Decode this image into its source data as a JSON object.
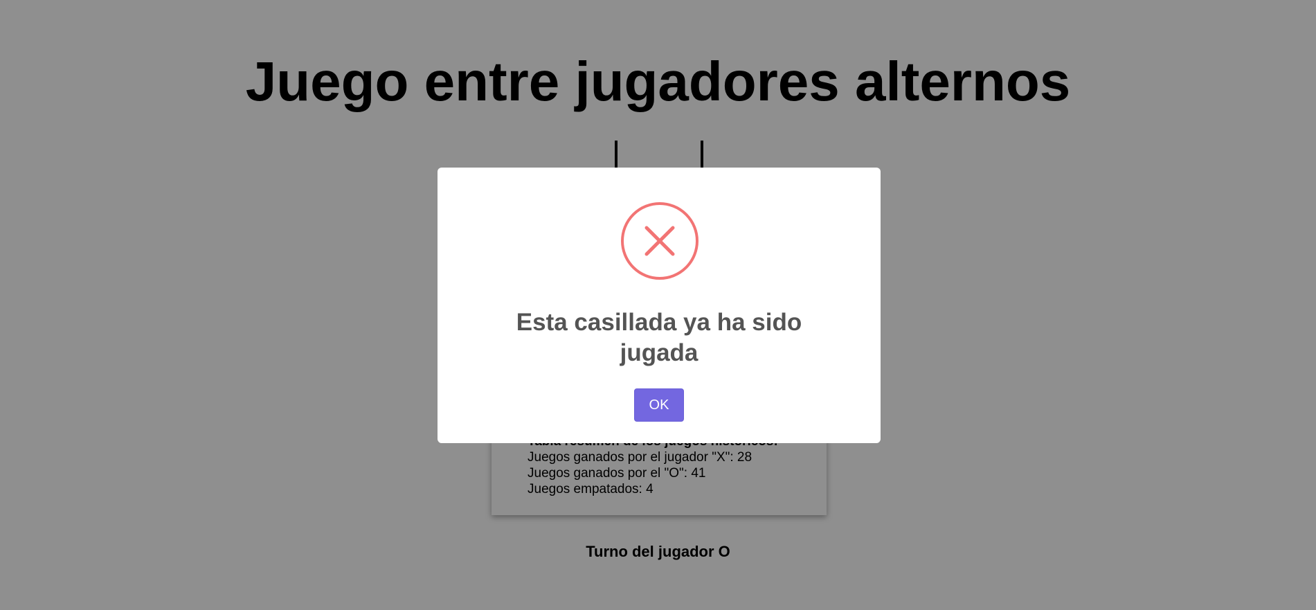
{
  "page": {
    "title": "Juego entre jugadores alternos"
  },
  "summary": {
    "heading": "Tabla resumen de los juegos históricos:",
    "x_wins": "Juegos ganados por el jugador \"X\": 28",
    "o_wins": "Juegos ganados por el \"O\": 41",
    "draws": "Juegos empatados: 4"
  },
  "turn": {
    "label": "Turno del jugador O"
  },
  "modal": {
    "icon": "error-x-icon",
    "title": "Esta casillada ya ha sido jugada",
    "ok_label": "OK"
  },
  "colors": {
    "error": "#f27474",
    "confirm_button": "#7367e0",
    "modal_title": "#545454"
  }
}
